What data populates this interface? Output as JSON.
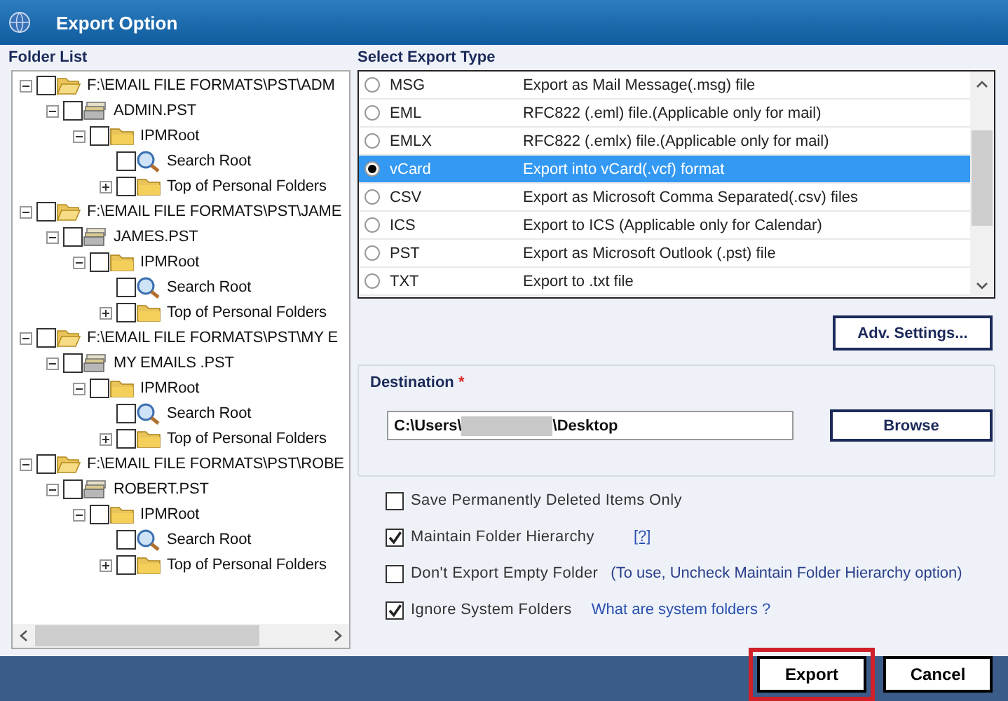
{
  "window": {
    "title": "Export Option"
  },
  "folder_list": {
    "label": "Folder List",
    "tree": [
      {
        "label": "F:\\EMAIL FILE FORMATS\\PST\\ADM",
        "kind": "drive",
        "expanded": true,
        "checked": false,
        "children": [
          {
            "label": "ADMIN.PST",
            "kind": "pst",
            "expanded": true,
            "checked": false,
            "children": [
              {
                "label": "IPMRoot",
                "kind": "folder",
                "expanded": true,
                "checked": false,
                "children": [
                  {
                    "label": "Search Root",
                    "kind": "search",
                    "checked": false
                  },
                  {
                    "label": "Top of Personal Folders",
                    "kind": "folder",
                    "expanded": false,
                    "checked": false
                  }
                ]
              }
            ]
          }
        ]
      },
      {
        "label": "F:\\EMAIL FILE FORMATS\\PST\\JAME",
        "kind": "drive",
        "expanded": true,
        "checked": false,
        "children": [
          {
            "label": "JAMES.PST",
            "kind": "pst",
            "expanded": true,
            "checked": false,
            "children": [
              {
                "label": "IPMRoot",
                "kind": "folder",
                "expanded": true,
                "checked": false,
                "children": [
                  {
                    "label": "Search Root",
                    "kind": "search",
                    "checked": false
                  },
                  {
                    "label": "Top of Personal Folders",
                    "kind": "folder",
                    "expanded": false,
                    "checked": false
                  }
                ]
              }
            ]
          }
        ]
      },
      {
        "label": "F:\\EMAIL FILE FORMATS\\PST\\MY E",
        "kind": "drive",
        "expanded": true,
        "checked": false,
        "children": [
          {
            "label": "MY EMAILS .PST",
            "kind": "pst",
            "expanded": true,
            "checked": false,
            "children": [
              {
                "label": "IPMRoot",
                "kind": "folder",
                "expanded": true,
                "checked": false,
                "children": [
                  {
                    "label": "Search Root",
                    "kind": "search",
                    "checked": false
                  },
                  {
                    "label": "Top of Personal Folders",
                    "kind": "folder",
                    "expanded": false,
                    "checked": false
                  }
                ]
              }
            ]
          }
        ]
      },
      {
        "label": "F:\\EMAIL FILE FORMATS\\PST\\ROBE",
        "kind": "drive",
        "expanded": true,
        "checked": false,
        "children": [
          {
            "label": "ROBERT.PST",
            "kind": "pst",
            "expanded": true,
            "checked": false,
            "children": [
              {
                "label": "IPMRoot",
                "kind": "folder",
                "expanded": true,
                "checked": false,
                "children": [
                  {
                    "label": "Search Root",
                    "kind": "search",
                    "checked": false
                  },
                  {
                    "label": "Top of Personal Folders",
                    "kind": "folder",
                    "expanded": false,
                    "checked": false
                  }
                ]
              }
            ]
          }
        ]
      }
    ]
  },
  "export_type": {
    "label": "Select Export Type",
    "options": [
      {
        "name": "MSG",
        "description": "Export as Mail Message(.msg) file",
        "selected": false
      },
      {
        "name": "EML",
        "description": "RFC822 (.eml) file.(Applicable only for mail)",
        "selected": false
      },
      {
        "name": "EMLX",
        "description": "RFC822 (.emlx) file.(Applicable only for mail)",
        "selected": false
      },
      {
        "name": "vCard",
        "description": "Export into vCard(.vcf) format",
        "selected": true
      },
      {
        "name": "CSV",
        "description": "Export as Microsoft Comma Separated(.csv) files",
        "selected": false
      },
      {
        "name": "ICS",
        "description": "Export to ICS (Applicable only for Calendar)",
        "selected": false
      },
      {
        "name": "PST",
        "description": "Export as Microsoft Outlook (.pst) file",
        "selected": false
      },
      {
        "name": "TXT",
        "description": "Export to .txt file",
        "selected": false
      }
    ],
    "adv_button": "Adv. Settings..."
  },
  "destination": {
    "label": "Destination",
    "required_mark": "*",
    "value_parts": [
      "C:\\Users\\",
      "\\Desktop"
    ],
    "redacted": true,
    "browse_button": "Browse"
  },
  "options": [
    {
      "label": "Save Permanently Deleted Items Only",
      "checked": false
    },
    {
      "label": "Maintain Folder Hierarchy",
      "checked": true,
      "aside": {
        "text": "[?]",
        "kind": "link"
      }
    },
    {
      "label": "Don't Export Empty Folder",
      "checked": false,
      "aside": {
        "text": "(To use, Uncheck Maintain Folder Hierarchy option)",
        "kind": "note"
      }
    },
    {
      "label": "Ignore System Folders",
      "checked": true,
      "aside": {
        "text": "What are system folders ?",
        "kind": "link"
      }
    }
  ],
  "footer": {
    "buttons": [
      {
        "label": "Export",
        "highlighted": true
      },
      {
        "label": "Cancel",
        "highlighted": false
      }
    ]
  }
}
